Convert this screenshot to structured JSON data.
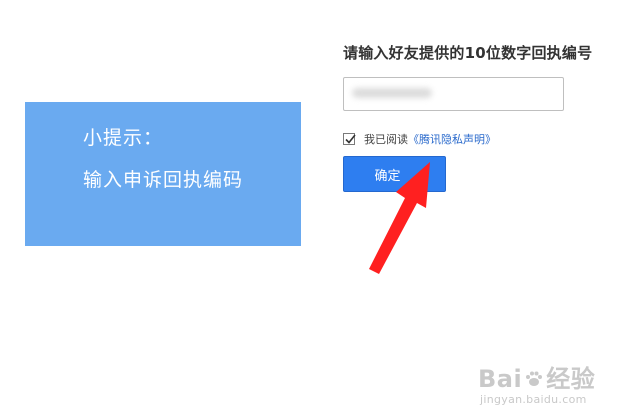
{
  "tip": {
    "title": "小提示：",
    "body": "输入申诉回执编码"
  },
  "form": {
    "prompt": "请输入好友提供的10位数字回执编号",
    "code_input_value": "",
    "agree_checked": true,
    "agree_prefix": "我已阅读",
    "privacy_link": "《腾讯隐私声明》",
    "confirm_label": "确定"
  },
  "watermark": {
    "brand_a": "Bai",
    "brand_b": "经验",
    "url": "jingyan.baidu.com"
  },
  "colors": {
    "tip_background": "#6aaaf0",
    "button": "#2e7ef0",
    "link": "#2a6acc",
    "arrow": "#ff2020"
  },
  "icons": {
    "check": "checkmark-icon",
    "arrow": "red-arrow-annotation",
    "paw": "paw-icon"
  }
}
